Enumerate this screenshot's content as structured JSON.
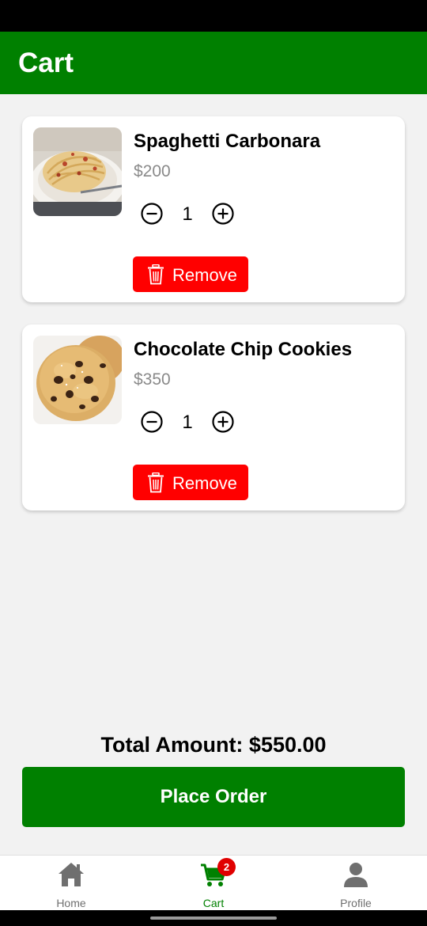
{
  "header": {
    "title": "Cart"
  },
  "cart": {
    "items": [
      {
        "name": "Spaghetti Carbonara",
        "price": "$200",
        "quantity": "1",
        "remove_label": "Remove",
        "image_icon": "spaghetti-carbonara-photo"
      },
      {
        "name": "Chocolate Chip Cookies",
        "price": "$350",
        "quantity": "1",
        "remove_label": "Remove",
        "image_icon": "chocolate-chip-cookie-photo"
      }
    ]
  },
  "summary": {
    "total_label": "Total Amount: $550.00",
    "place_order_label": "Place Order"
  },
  "bottom_nav": {
    "items": [
      {
        "label": "Home",
        "icon": "home-icon"
      },
      {
        "label": "Cart",
        "icon": "cart-icon",
        "badge": "2",
        "active": true
      },
      {
        "label": "Profile",
        "icon": "profile-icon"
      }
    ]
  },
  "colors": {
    "primary": "#008000",
    "danger": "#ff0000",
    "background": "#f2f2f2",
    "muted": "#8a8a8a",
    "badge": "#e00000"
  }
}
